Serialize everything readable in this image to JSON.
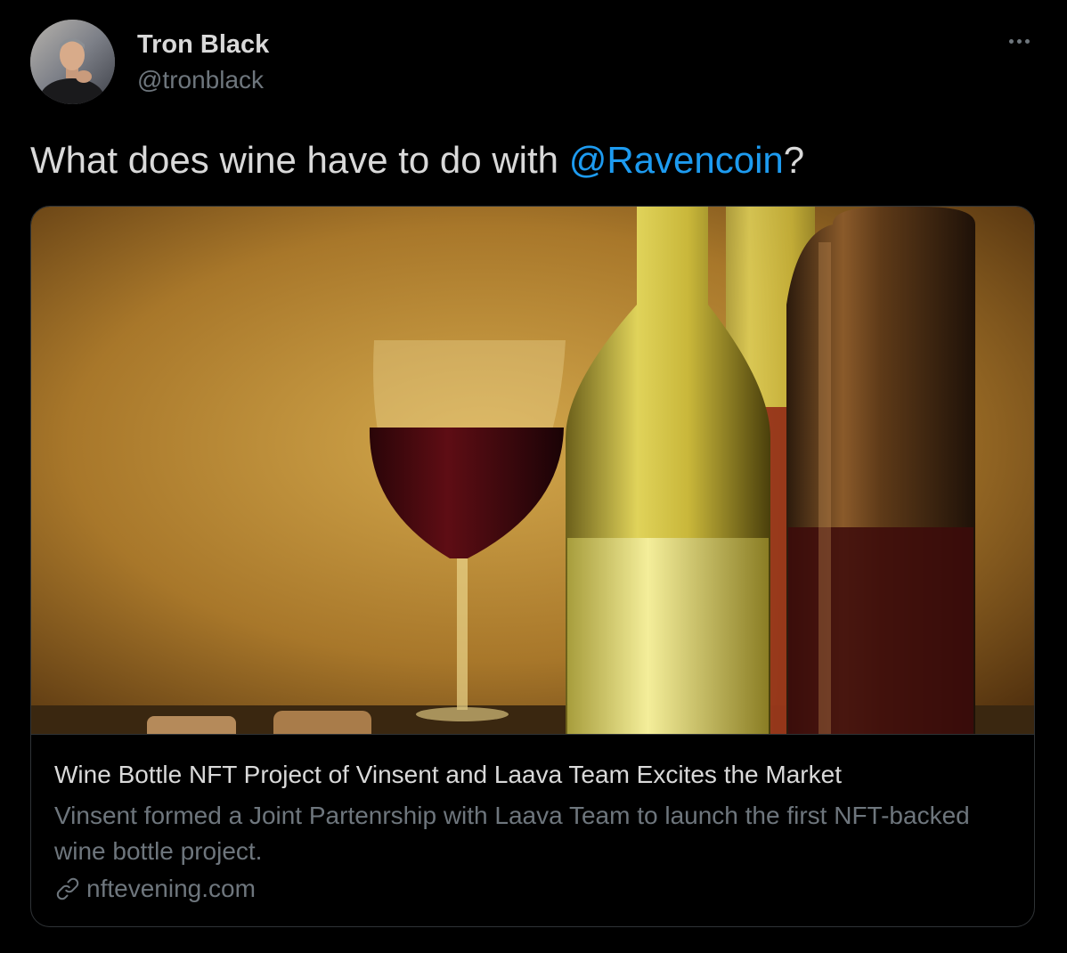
{
  "author": {
    "name": "Tron Black",
    "handle": "@tronblack"
  },
  "tweet": {
    "text_before": "What does wine have to do with ",
    "mention": "@Ravencoin",
    "text_after": "?"
  },
  "card": {
    "title": "Wine Bottle NFT Project of Vinsent and Laava Team Excites the Market",
    "description": "Vinsent formed a Joint Partenrship with Laava Team to launch the first NFT-backed wine bottle project.",
    "domain": "nftevening.com"
  },
  "icons": {
    "more": "more-horizontal-icon",
    "link": "link-icon"
  },
  "colors": {
    "background": "#000000",
    "primary_text": "#d9d9d9",
    "secondary_text": "#6e767d",
    "accent": "#1d9bf0",
    "border": "#2f3336"
  }
}
